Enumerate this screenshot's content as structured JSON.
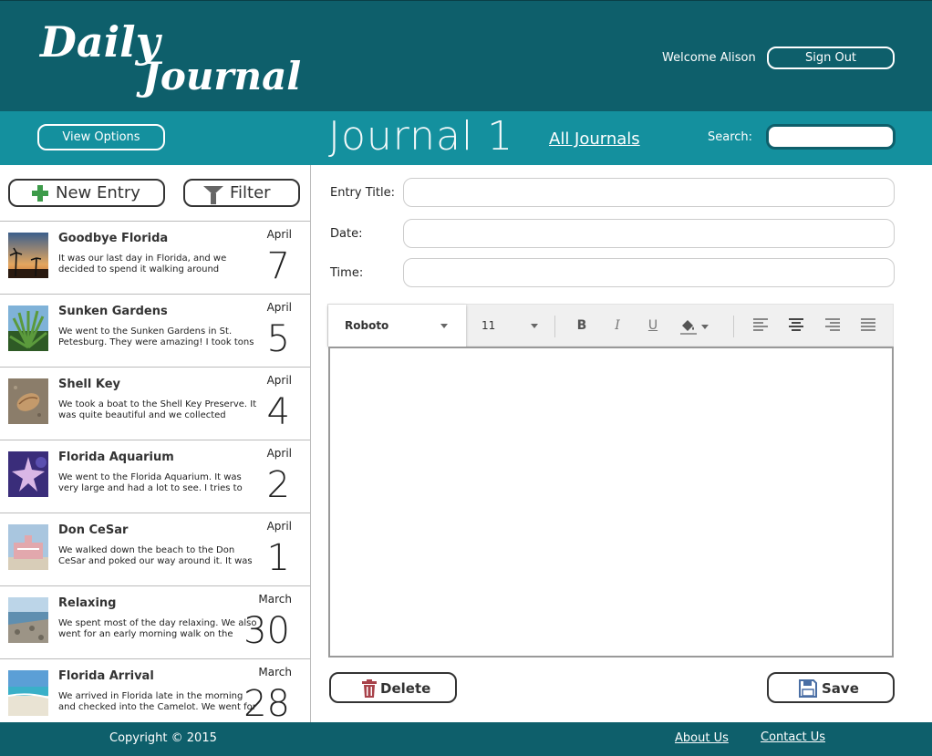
{
  "header": {
    "logo_line1": "Daily",
    "logo_line2": "Journal",
    "welcome": "Welcome Alison",
    "signout_label": "Sign Out"
  },
  "subbar": {
    "view_options_label": "View Options",
    "journal_title": "Journal 1",
    "all_journals_label": "All Journals",
    "search_label": "Search:",
    "search_value": ""
  },
  "sidebar": {
    "new_entry_label": "New Entry",
    "filter_label": "Filter",
    "entries": [
      {
        "title": "Goodbye Florida",
        "preview": "It was our last day in Florida, and we decided to spend it walking around",
        "month": "April",
        "day": "7",
        "thumb": "sunset-palms"
      },
      {
        "title": "Sunken Gardens",
        "preview": "We went to the Sunken Gardens in St. Petesburg. They were amazing! I took tons",
        "month": "April",
        "day": "5",
        "thumb": "palm-plant"
      },
      {
        "title": "Shell Key",
        "preview": "We took a boat to the Shell Key Preserve. It was quite beautiful and we collected",
        "month": "April",
        "day": "4",
        "thumb": "seashell"
      },
      {
        "title": "Florida Aquarium",
        "preview": "We went to the Florida Aquarium. It was very large and had a lot to see. I tries to",
        "month": "April",
        "day": "2",
        "thumb": "starfish"
      },
      {
        "title": "Don CeSar",
        "preview": "We walked down the beach to the Don CeSar and poked our way around it. It was",
        "month": "April",
        "day": "1",
        "thumb": "pink-hotel"
      },
      {
        "title": "Relaxing",
        "preview": "We spent most of the day relaxing. We also went for an early morning walk on the",
        "month": "March",
        "day": "30",
        "thumb": "beach-rocks"
      },
      {
        "title": "Florida Arrival",
        "preview": "We arrived in Florida late in the morning and checked into the Camelot. We went for",
        "month": "March",
        "day": "28",
        "thumb": "beach-sky"
      }
    ]
  },
  "form": {
    "entry_title_label": "Entry Title:",
    "date_label": "Date:",
    "time_label": "Time:",
    "entry_title_value": "",
    "date_value": "",
    "time_value": ""
  },
  "toolbar": {
    "font": "Roboto",
    "size": "11",
    "bold": "B",
    "italic": "I",
    "underline": "U"
  },
  "actions": {
    "delete_label": "Delete",
    "save_label": "Save"
  },
  "footer": {
    "copyright": "Copyright © 2015",
    "about": "About Us",
    "contact": "Contact Us"
  },
  "colors": {
    "header": "#0e5f6b",
    "subbar": "#14909e",
    "plus_green": "#3d9b4a",
    "trash_red": "#a8424a",
    "disk_blue": "#4a6fa5"
  }
}
